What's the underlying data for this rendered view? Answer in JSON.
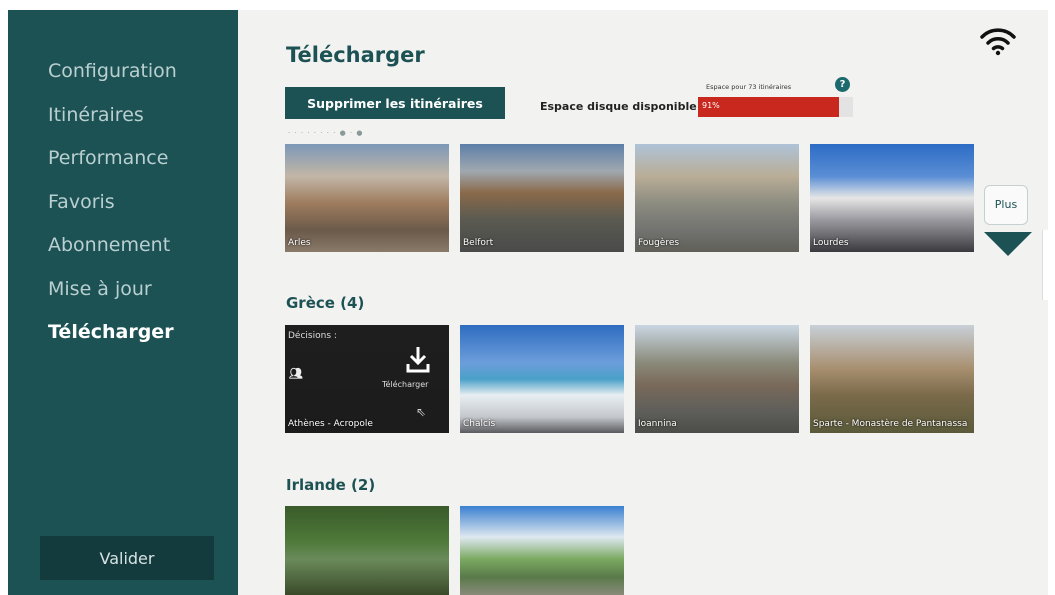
{
  "sidebar": {
    "items": [
      {
        "label": "Configuration"
      },
      {
        "label": "Itinéraires"
      },
      {
        "label": "Performance"
      },
      {
        "label": "Favoris"
      },
      {
        "label": "Abonnement"
      },
      {
        "label": "Mise à jour"
      },
      {
        "label": "Télécharger",
        "active": true
      }
    ],
    "validate_label": "Valider"
  },
  "main": {
    "title": "Télécharger",
    "delete_label": "Supprimer les itinéraires",
    "space_note": "Espace pour 73 itinéraires",
    "help_label": "?",
    "disk_label": "Espace disque disponible :",
    "disk_percent_label": "91%",
    "disk_fill": 0.91,
    "plus_label": "Plus",
    "first_row": [
      {
        "label": "Arles"
      },
      {
        "label": "Belfort"
      },
      {
        "label": "Fougères"
      },
      {
        "label": "Lourdes"
      }
    ],
    "sections": [
      {
        "title": "Grèce (4)",
        "tiles": [
          {
            "label": "Athènes - Acropole",
            "decisions_label": "Décisions :",
            "download_label": "Télécharger"
          },
          {
            "label": "Chalcis"
          },
          {
            "label": "Ioannina"
          },
          {
            "label": "Sparte - Monastère de Pantanassa"
          }
        ]
      },
      {
        "title": "Irlande (2)",
        "tiles": [
          {
            "label": ""
          },
          {
            "label": ""
          }
        ]
      }
    ]
  },
  "colors": {
    "sidebar": "#1d5255",
    "accent": "#1d5255",
    "disk_bar": "#c8281e"
  }
}
